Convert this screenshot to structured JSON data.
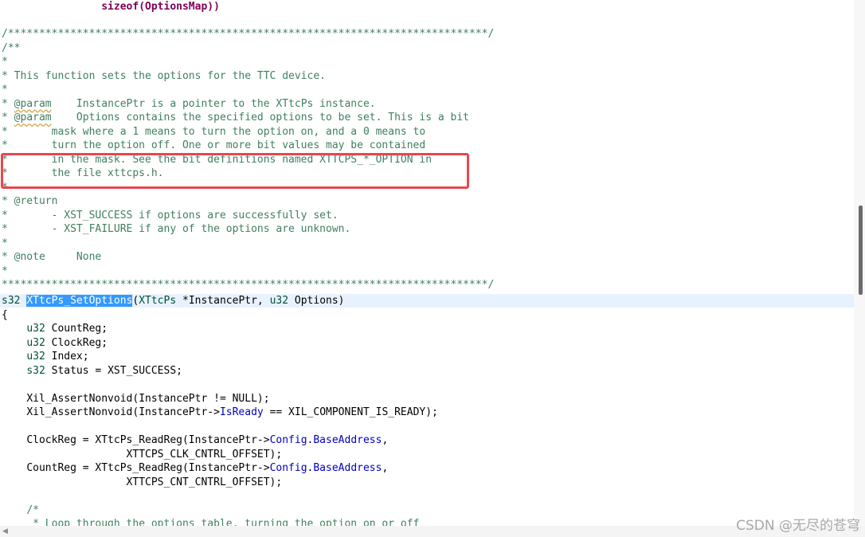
{
  "code": {
    "l00": "sizeof(OptionsMap))",
    "l01": "/*****************************************************************************/",
    "l02": "/**",
    "l03": "*",
    "l04": "* This function sets the options for the TTC device.",
    "l05": "*",
    "l06a": "* ",
    "l06b": "@param",
    "l06c": "    InstancePtr is a pointer to the XTtcPs instance.",
    "l07a": "* ",
    "l07b": "@param",
    "l07c": "    Options contains the specified options to be set. This is a bit",
    "l08": "*       mask where a 1 means to turn the option on, and a 0 means to",
    "l09": "*       turn the option off. One or more bit values may be contained",
    "l10": "*       in the mask. See the bit definitions named XTTCPS_*_OPTION in",
    "l11": "*       the file xttcps.h.",
    "l12": "*",
    "l13": "* @return",
    "l14": "*       - XST_SUCCESS if options are successfully set.",
    "l15": "*       - XST_FAILURE if any of the options are unknown.",
    "l16": "*",
    "l17": "* @note     None",
    "l18": "*",
    "l19": "******************************************************************************/",
    "l20_type": "s32",
    "l20_fn": "XTtcPs_SetOptions",
    "l20_p1": "(",
    "l20_t2": "XTtcPs",
    "l20_p2": " *InstancePtr, ",
    "l20_t3": "u32",
    "l20_p3": " Options)",
    "l21": "{",
    "l22_t": "u32",
    "l22_r": " CountReg;",
    "l23_t": "u32",
    "l23_r": " ClockReg;",
    "l24_t": "u32",
    "l24_r": " Index;",
    "l25_t": "s32",
    "l25_r": " Status = XST_SUCCESS;",
    "l27": "Xil_AssertNonvoid(InstancePtr != NULL);",
    "l28a": "Xil_AssertNonvoid(InstancePtr->",
    "l28b": "IsReady",
    "l28c": " == XIL_COMPONENT_IS_READY);",
    "l30a": "ClockReg = XTtcPs_ReadReg(InstancePtr->",
    "l30b": "Config",
    "l30c": ".",
    "l30d": "BaseAddress",
    "l30e": ",",
    "l31": "XTTCPS_CLK_CNTRL_OFFSET);",
    "l32a": "CountReg = XTtcPs_ReadReg(InstancePtr->",
    "l32b": "Config",
    "l32c": ".",
    "l32d": "BaseAddress",
    "l32e": ",",
    "l33": "XTTCPS_CNT_CNTRL_OFFSET);",
    "l35": "/*",
    "l36": "* Loop through the options table, turning the option on or off"
  },
  "watermark": "CSDN @无尽的苍穹",
  "colors": {
    "comment": "#3f7f5f",
    "keyword": "#7f0055",
    "field": "#0000c0",
    "selection": "#3399ff",
    "current_line": "#e8f2fe",
    "annotation_box": "#e8474f"
  }
}
